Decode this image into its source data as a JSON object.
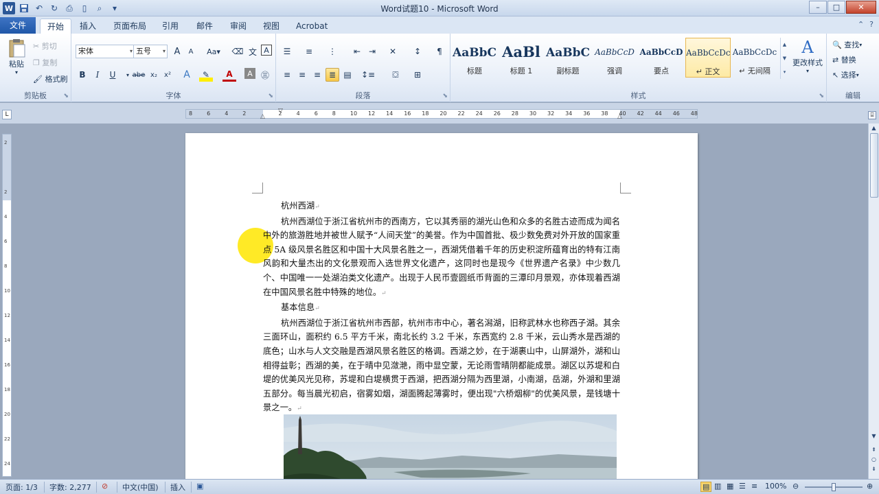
{
  "window": {
    "title": "Word试题10 - Microsoft Word",
    "app_icon_label": "W",
    "controls": {
      "minimize": "–",
      "maximize": "□",
      "close": "✕"
    }
  },
  "tabs": {
    "file": "文件",
    "items": [
      "开始",
      "插入",
      "页面布局",
      "引用",
      "邮件",
      "审阅",
      "视图",
      "Acrobat"
    ],
    "active": "开始"
  },
  "ribbon": {
    "clipboard": {
      "label": "剪贴板",
      "paste": "粘贴",
      "cut": "剪切",
      "copy": "复制",
      "format_painter": "格式刷"
    },
    "font": {
      "label": "字体",
      "font_name": "宋体",
      "font_size": "五号",
      "grow": "A",
      "shrink": "A",
      "bold": "B",
      "italic": "I",
      "underline": "U",
      "strike": "abe",
      "subscript": "x₂",
      "superscript": "x²"
    },
    "paragraph": {
      "label": "段落"
    },
    "styles": {
      "label": "样式",
      "items": [
        {
          "preview": "AaBbC",
          "name": "标题"
        },
        {
          "preview": "AaBl",
          "name": "标题 1"
        },
        {
          "preview": "AaBbC",
          "name": "副标题"
        },
        {
          "preview": "AaBbCcD",
          "name": "强调"
        },
        {
          "preview": "AaBbCcD",
          "name": "要点"
        },
        {
          "preview": "AaBbCcDc",
          "name": "↵ 正文"
        },
        {
          "preview": "AaBbCcDc",
          "name": "↵ 无间隔"
        }
      ],
      "selected_index": 5,
      "change_styles": "更改样式"
    },
    "editing": {
      "label": "编辑",
      "find": "查找",
      "replace": "替换",
      "select": "选择"
    }
  },
  "ruler": {
    "numbers": [
      "8",
      "6",
      "4",
      "2",
      "",
      "2",
      "4",
      "6",
      "8",
      "10",
      "12",
      "14",
      "16",
      "18",
      "20",
      "22",
      "24",
      "26",
      "28",
      "30",
      "32",
      "34",
      "36",
      "38",
      "40",
      "42",
      "44",
      "46",
      "48"
    ],
    "vertical_numbers": [
      "2",
      "",
      "2",
      "4",
      "6",
      "8",
      "10",
      "12",
      "14",
      "16",
      "18",
      "20",
      "22",
      "24"
    ]
  },
  "document": {
    "heading1": "杭州西湖",
    "para1": "杭州西湖位于浙江省杭州市的西南方，它以其秀丽的湖光山色和众多的名胜古迹而成为闻名中外的旅游胜地并被世人赋予“人间天堂”的美誉。作为中国首批、极少数免费对外开放的国家重点 5A 级风景名胜区和中国十大风景名胜之一，西湖凭借着千年的历史积淀所蕴育出的特有江南风韵和大量杰出的文化景观而入选世界文化遗产，这同时也是现今《世界遗产名录》中少数几个、中国唯一一处湖泊类文化遗产。出现于人民币壹圆纸币背面的三潭印月景观，亦体现着西湖在中国风景名胜中特殊的地位。",
    "heading2": "基本信息",
    "para2": "杭州西湖位于浙江省杭州市西部，杭州市市中心，著名潟湖，旧称武林水也称西子湖。其余三面环山，面积约 6.5 平方千米，南北长约 3.2 千米，东西宽约 2.8 千米，云山秀水是西湖的底色；山水与人文交融是西湖风景名胜区的格调。西湖之妙，在于湖裹山中，山屏湖外，湖和山相得益彰；西湖的美，在于晴中见潋滟，雨中显空蒙，无论雨雪晴阴都能成景。湖区以苏堤和白堤的优美风光见称，苏堤和白堤横贯于西湖，把西湖分隔为西里湖，小南湖，岳湖，外湖和里湖五部分。每当晨光初启，宿雾如烟，湖面腾起薄雾时，便出现\"六桥烟柳\"的优美风景，是钱塘十景之一。",
    "para_mark": "↵"
  },
  "status": {
    "page": "页面: 1/3",
    "words": "字数: 2,277",
    "language": "中文(中国)",
    "mode": "插入",
    "zoom": "100%",
    "zoom_fraction": 0.5
  }
}
